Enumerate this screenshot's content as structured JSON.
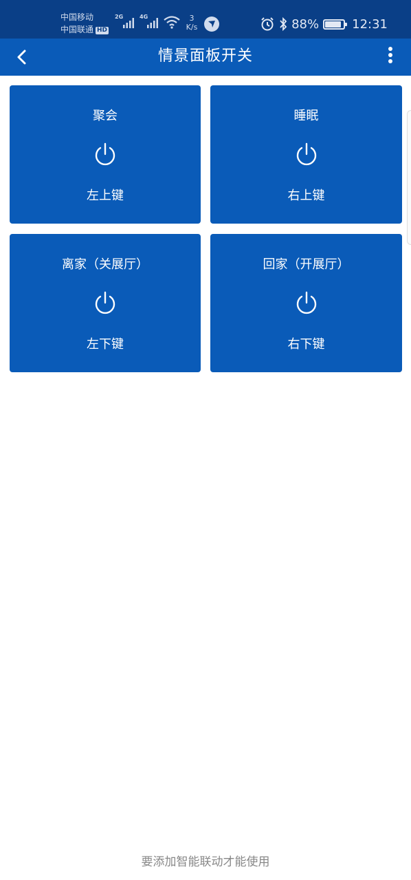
{
  "status_bar": {
    "carrier_1": "中国移动",
    "carrier_2": "中国联通",
    "hd_badge": "HD",
    "net_1": "2G",
    "net_2": "4G",
    "speed_value": "3",
    "speed_unit": "K/s",
    "battery": "88%",
    "battery_level": 0.88,
    "time": "12:31"
  },
  "header": {
    "title": "情景面板开关",
    "back_icon": "chevron-left-icon",
    "menu_icon": "more-vertical-icon"
  },
  "scenes": [
    {
      "name": "聚会",
      "key": "左上键"
    },
    {
      "name": "睡眠",
      "key": "右上键"
    },
    {
      "name": "离家（关展厅）",
      "key": "左下键"
    },
    {
      "name": "回家（开展厅）",
      "key": "右下键"
    }
  ],
  "footer": {
    "hint": "要添加智能联动才能使用"
  },
  "colors": {
    "status_bar_bg": "#0a3f87",
    "primary": "#0a5bb8",
    "tile_text": "#ffffff",
    "hint_text": "#888888"
  }
}
